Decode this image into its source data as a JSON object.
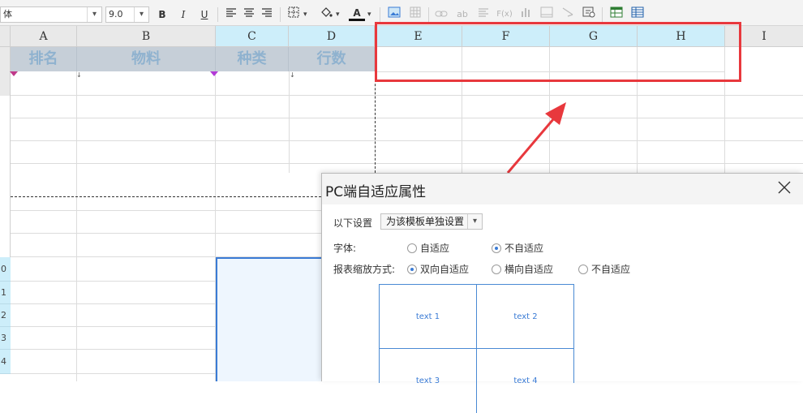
{
  "toolbar": {
    "font_name": "体",
    "font_size": "9.0",
    "bold_label": "B",
    "italic_label": "I",
    "underline_label": "U",
    "font_color_label": "A",
    "ab_label": "ab",
    "fx_label": "F(x)"
  },
  "columns": [
    "A",
    "B",
    "C",
    "D",
    "E",
    "F",
    "G",
    "H",
    "I"
  ],
  "title_row": [
    "排名",
    "物料",
    "种类",
    "行数"
  ],
  "row_numbers": [
    "0",
    "1",
    "2",
    "3",
    "4"
  ],
  "dialog": {
    "title": "PC端自适应属性",
    "settings_label": "以下设置",
    "settings_value": "为该模板单独设置",
    "font_label": "字体:",
    "font_options": [
      "自适应",
      "不自适应"
    ],
    "font_selected": "不自适应",
    "scale_label": "报表缩放方式:",
    "scale_options": [
      "双向自适应",
      "横向自适应",
      "不自适应"
    ],
    "scale_selected": "双向自适应",
    "preview_cells": [
      "text 1",
      "text 2",
      "text 3",
      "text 4"
    ]
  },
  "colors": {
    "highlight_red": "#e8383d",
    "selected_header": "#cdeefa",
    "title_bg": "#c6cfd8",
    "title_text": "#8fb2cf",
    "accent_blue": "#3a7bd5"
  }
}
